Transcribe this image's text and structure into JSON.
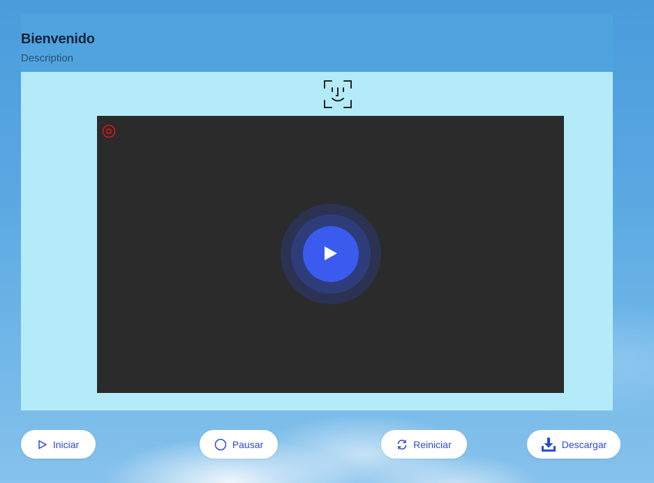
{
  "card": {
    "title": "Bienvenido",
    "description": "Description"
  },
  "icons": {
    "face": "face-id-icon",
    "record": "record-indicator-icon",
    "play": "play-icon"
  },
  "colors": {
    "header_bg": "#4fa4e0",
    "body_bg": "#b4ebf9",
    "video_bg": "#2b2b2b",
    "play_accent": "#3b5bef",
    "record_red": "#e01515",
    "button_text": "#2a49d8"
  },
  "controls": {
    "start": {
      "label": "Iniciar",
      "icon": "play-outline-icon"
    },
    "pause": {
      "label": "Pausar",
      "icon": "circle-outline-icon"
    },
    "restart": {
      "label": "Reiniciar",
      "icon": "refresh-icon"
    },
    "download": {
      "label": "Descargar",
      "icon": "download-icon"
    }
  }
}
